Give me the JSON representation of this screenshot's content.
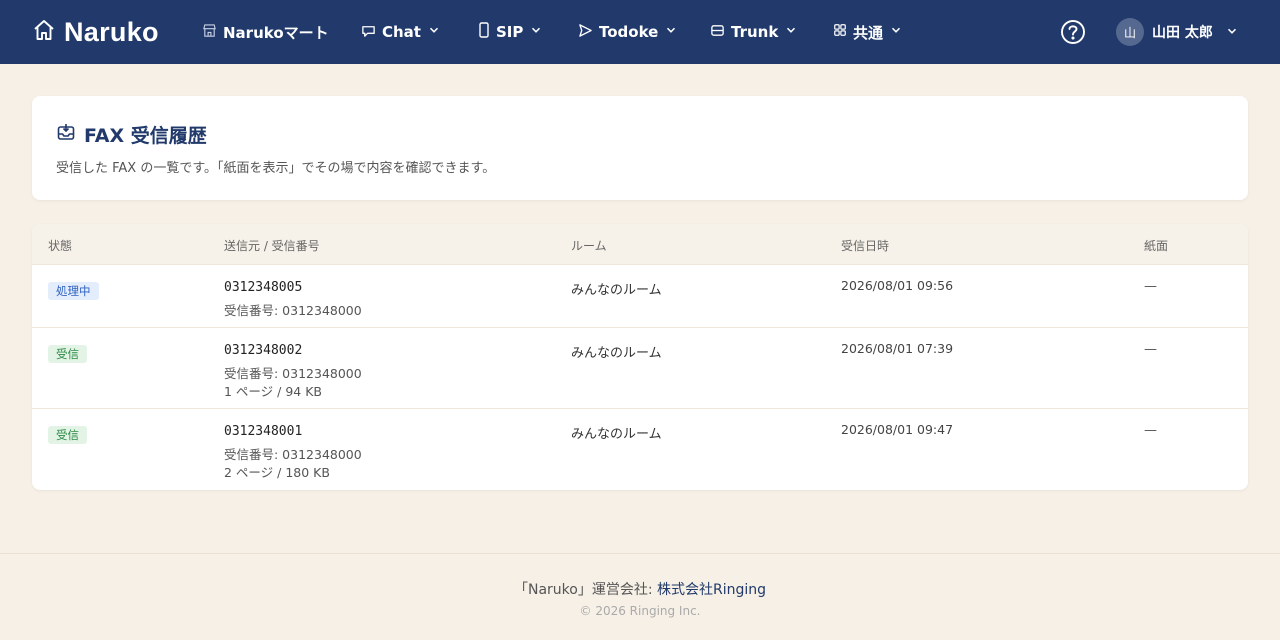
{
  "colors": {
    "nav_bg": "#213a6b",
    "page_bg": "#f6f0e6",
    "accent": "#213a6b",
    "badge_processing": "#2f63c2",
    "badge_received": "#2e8a46"
  },
  "nav": {
    "brand": "Naruko",
    "brand_icon": "home-icon",
    "items": [
      {
        "label": "Narukoマート",
        "icon": "store-icon",
        "has_dropdown": false
      },
      {
        "label": "Chat",
        "icon": "chat-icon",
        "has_dropdown": true
      },
      {
        "label": "SIP",
        "icon": "phone-icon",
        "has_dropdown": true
      },
      {
        "label": "Todoke",
        "icon": "send-icon",
        "has_dropdown": true
      },
      {
        "label": "Trunk",
        "icon": "server-icon",
        "has_dropdown": true
      },
      {
        "label": "共通",
        "icon": "grid-icon",
        "has_dropdown": true
      }
    ],
    "help_icon": "help-circle-icon",
    "user": {
      "avatar_initial": "山",
      "name": "山田 太郎"
    }
  },
  "page": {
    "title": "FAX 受信履歴",
    "title_icon": "inbox-icon",
    "description": "受信した FAX の一覧です。「紙面を表示」でその場で内容を確認できます。"
  },
  "table": {
    "columns": [
      "状態",
      "送信元 / 受信番号",
      "ルーム",
      "受信日時",
      "紙面"
    ],
    "rows": [
      {
        "status": "処理中",
        "status_type": "processing",
        "sender": "0312348005",
        "receiver": "受信番号: 0312348000",
        "pages": "",
        "room": "みんなのルーム",
        "received_at": "2026/08/01 09:56",
        "paper": "—"
      },
      {
        "status": "受信",
        "status_type": "received",
        "sender": "0312348002",
        "receiver": "受信番号: 0312348000",
        "pages": "1 ページ / 94 KB",
        "room": "みんなのルーム",
        "received_at": "2026/08/01 07:39",
        "paper": "—"
      },
      {
        "status": "受信",
        "status_type": "received",
        "sender": "0312348001",
        "receiver": "受信番号: 0312348000",
        "pages": "2 ページ / 180 KB",
        "room": "みんなのルーム",
        "received_at": "2026/08/01 09:47",
        "paper": "—"
      }
    ]
  },
  "footer": {
    "prefix": "「Naruko」運営会社: ",
    "company": "株式会社Ringing",
    "copyright": "© 2026 Ringing Inc."
  }
}
